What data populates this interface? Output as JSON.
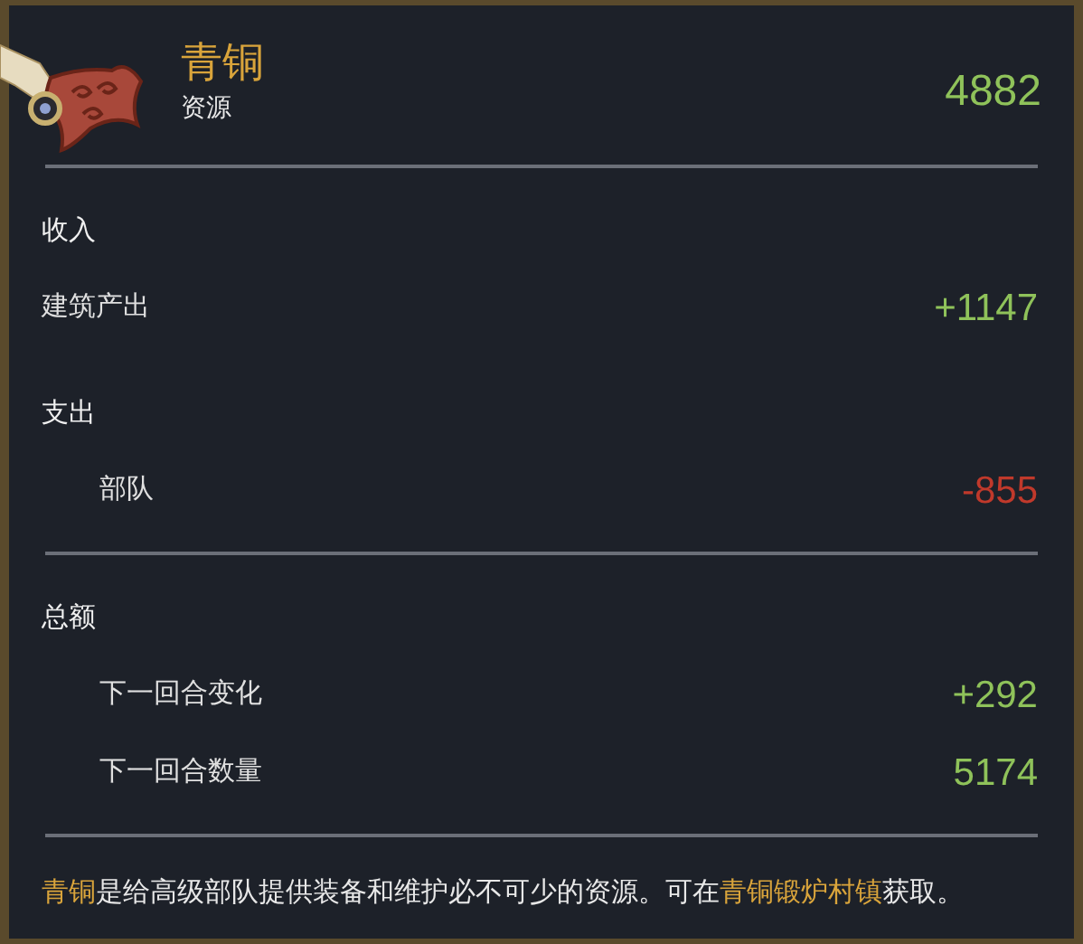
{
  "header": {
    "title": "青铜",
    "subtitle": "资源",
    "amount": "4882"
  },
  "groups": [
    {
      "sections": [
        {
          "title": "收入",
          "items": [
            {
              "label": "建筑产出",
              "value": "+1147",
              "indented": false,
              "color": "#8fc25a"
            }
          ]
        },
        {
          "title": "支出",
          "items": [
            {
              "label": "部队",
              "value": "-855",
              "indented": true,
              "color": "#c0392b"
            }
          ]
        }
      ]
    },
    {
      "sections": [
        {
          "title": "总额",
          "items": [
            {
              "label": "下一回合变化",
              "value": "+292",
              "indented": true,
              "color": "#8fc25a"
            },
            {
              "label": "下一回合数量",
              "value": "5174",
              "indented": true,
              "color": "#8fc25a"
            }
          ]
        }
      ]
    }
  ],
  "description": [
    {
      "text": "青铜",
      "highlight": true
    },
    {
      "text": "是给高级部队提供装备和维护必不可少的资源。可在",
      "highlight": false
    },
    {
      "text": "青铜锻炉村镇",
      "highlight": true
    },
    {
      "text": "获取。",
      "highlight": false
    }
  ]
}
